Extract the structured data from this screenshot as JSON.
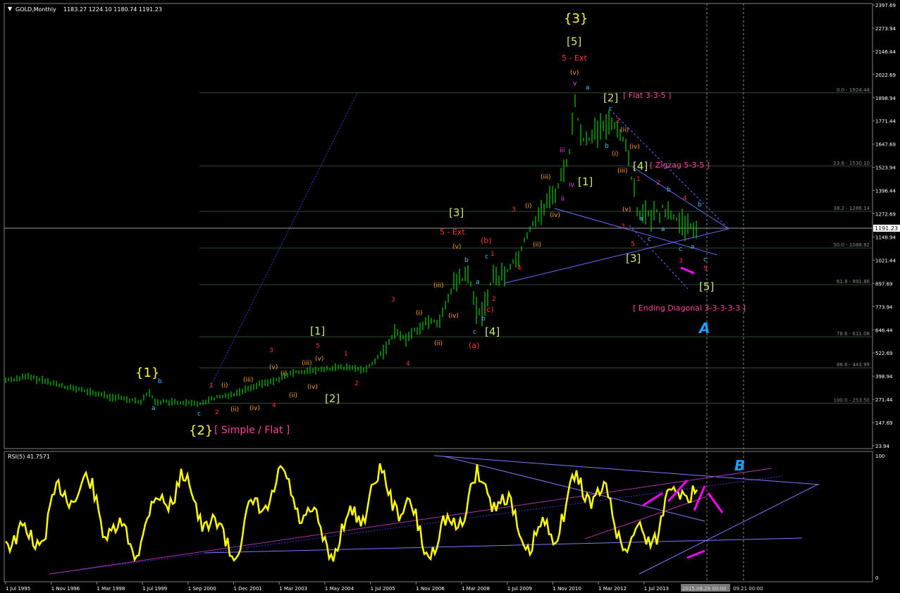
{
  "header": {
    "symbol_label": "GOLD,Monthly",
    "ohlc": "1183.27 1224.10 1180.74 1191.23",
    "rsi_label": "RSI(5) 41.7571"
  },
  "price_scale": [
    "2397.69",
    "2273.94",
    "2146.44",
    "2022.69",
    "1898.94",
    "1771.44",
    "1647.69",
    "1523.94",
    "1396.44",
    "1272.69",
    "1148.94",
    "1021.44",
    "897.69",
    "773.94",
    "646.44",
    "522.69",
    "398.94",
    "271.44",
    "147.69",
    "23.94"
  ],
  "current_price": "1191.23",
  "rsi_scale": [
    "100",
    "0"
  ],
  "time_axis": [
    "1 Jul 1995",
    "1 Nov 1996",
    "1 Mar 1998",
    "1 Jul 1999",
    "1 Sep 2000",
    "1 Dec 2001",
    "1 Mar 2003",
    "1 May 2004",
    "1 Jul 2005",
    "1 Nov 2006",
    "1 Mar 2008",
    "1 Jul 2009",
    "1 Nov 2010",
    "1 Mar 2012",
    "1 Jul 2013"
  ],
  "time_marker": "2015.08.29 00:00",
  "time_marker2": "09.21 00:00",
  "colors": {
    "background": "#000000",
    "candle": "#00d000",
    "rsi_line": "#ffff00",
    "fib_line": "#2e4a2e",
    "trend_line": "#7b7bff",
    "magenta": "#ff00ff",
    "wave_red": "#ff3030",
    "wave_yellow": "#ffff30",
    "wave_green": "#c8e870",
    "wave_orange": "#ffa030",
    "wave_cyan": "#40c8ff",
    "pink": "#ff40a0",
    "abc_blue": "#1ea0ff"
  },
  "chart_data": [
    {
      "type": "candlestick",
      "title": "GOLD,Monthly",
      "ylim": [
        23.94,
        2397.69
      ],
      "fib_levels": [
        {
          "label": "0.0 - 1924.44",
          "value": 1924.44
        },
        {
          "label": "23.6 - 1530.10",
          "value": 1530.1
        },
        {
          "label": "38.2 - 1286.14",
          "value": 1286.14
        },
        {
          "label": "50.0 - 1088.92",
          "value": 1088.92
        },
        {
          "label": "61.8 - 891.86",
          "value": 891.86
        },
        {
          "label": "78.6 - 611.08",
          "value": 611.08
        },
        {
          "label": "88.6 - 443.99",
          "value": 443.99
        },
        {
          "label": "100.0 - 253.50",
          "value": 253.5
        }
      ],
      "annotations": {
        "brace_3": "{3}",
        "box_5_top": "[5]",
        "ext_top": "5 - Ext",
        "v_top": "(v)",
        "v_small": "v",
        "box_2_flat": "[2]",
        "flat_label": "[ Flat 3-3-5 ]",
        "box_4_zig": "[4]",
        "zig_label": "[ Zigzag 5-3-5 ]",
        "box_1_mid": "[1]",
        "box_3_low": "[3]",
        "box_5_low": "[5]",
        "ending_diag": "[ Ending Diagonal 3-3-3-3-3 ]",
        "box_3_2008": "[3]",
        "ext_2008": "5 - Ext",
        "box_4_2008": "[4]",
        "b_paren": "(b)",
        "c_paren": "(c)",
        "a_paren": "(a)",
        "box_1_2003": "[1]",
        "box_2_2004": "[2]",
        "brace_1": "{1}",
        "brace_2": "{2}",
        "simple_flat": "[ Simple / Flat ]",
        "label_A": "A",
        "label_B": "B"
      }
    },
    {
      "type": "line",
      "title": "RSI(5) 41.7571",
      "ylim": [
        0,
        100
      ]
    }
  ]
}
